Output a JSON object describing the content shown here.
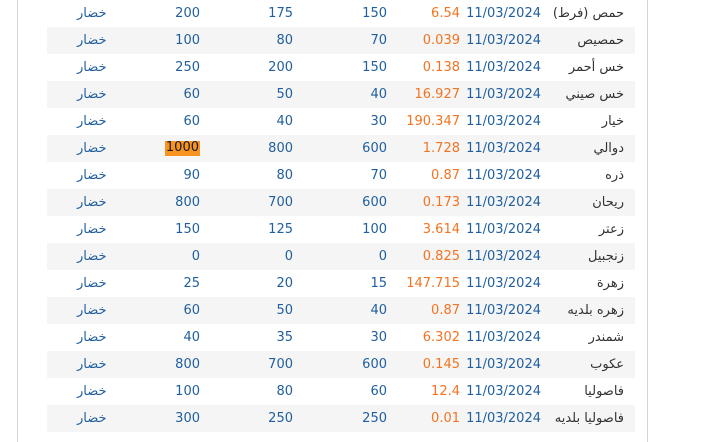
{
  "rows": [
    {
      "name": "حمص (فرط)",
      "date": "11/03/2024",
      "price": "6.54",
      "n1": "150",
      "n2": "175",
      "n3": "200",
      "type": "خضار"
    },
    {
      "name": "حمصيص",
      "date": "11/03/2024",
      "price": "0.039",
      "n1": "70",
      "n2": "80",
      "n3": "100",
      "type": "خضار"
    },
    {
      "name": "خس أحمر",
      "date": "11/03/2024",
      "price": "0.138",
      "n1": "150",
      "n2": "200",
      "n3": "250",
      "type": "خضار"
    },
    {
      "name": "خس صيني",
      "date": "11/03/2024",
      "price": "16.927",
      "n1": "40",
      "n2": "50",
      "n3": "60",
      "type": "خضار"
    },
    {
      "name": "خيار",
      "date": "11/03/2024",
      "price": "190.347",
      "n1": "30",
      "n2": "40",
      "n3": "60",
      "type": "خضار"
    },
    {
      "name": "دوالي",
      "date": "11/03/2024",
      "price": "1.728",
      "n1": "600",
      "n2": "800",
      "n3": "1000",
      "type": "خضار",
      "highlight": true
    },
    {
      "name": "ذره",
      "date": "11/03/2024",
      "price": "0.87",
      "n1": "70",
      "n2": "80",
      "n3": "90",
      "type": "خضار"
    },
    {
      "name": "ريحان",
      "date": "11/03/2024",
      "price": "0.173",
      "n1": "600",
      "n2": "700",
      "n3": "800",
      "type": "خضار"
    },
    {
      "name": "زعتر",
      "date": "11/03/2024",
      "price": "3.614",
      "n1": "100",
      "n2": "125",
      "n3": "150",
      "type": "خضار"
    },
    {
      "name": "زنجبيل",
      "date": "11/03/2024",
      "price": "0.825",
      "n1": "0",
      "n2": "0",
      "n3": "0",
      "type": "خضار"
    },
    {
      "name": "زهرة",
      "date": "11/03/2024",
      "price": "147.715",
      "n1": "15",
      "n2": "20",
      "n3": "25",
      "type": "خضار"
    },
    {
      "name": "زهره بلديه",
      "date": "11/03/2024",
      "price": "0.87",
      "n1": "40",
      "n2": "50",
      "n3": "60",
      "type": "خضار"
    },
    {
      "name": "شمندر",
      "date": "11/03/2024",
      "price": "6.302",
      "n1": "30",
      "n2": "35",
      "n3": "40",
      "type": "خضار"
    },
    {
      "name": "عكوب",
      "date": "11/03/2024",
      "price": "0.145",
      "n1": "600",
      "n2": "700",
      "n3": "800",
      "type": "خضار"
    },
    {
      "name": "فاصوليا",
      "date": "11/03/2024",
      "price": "12.4",
      "n1": "60",
      "n2": "80",
      "n3": "100",
      "type": "خضار"
    },
    {
      "name": "فاصوليا بلديه",
      "date": "11/03/2024",
      "price": "0.01",
      "n1": "250",
      "n2": "250",
      "n3": "300",
      "type": "خضار"
    }
  ]
}
